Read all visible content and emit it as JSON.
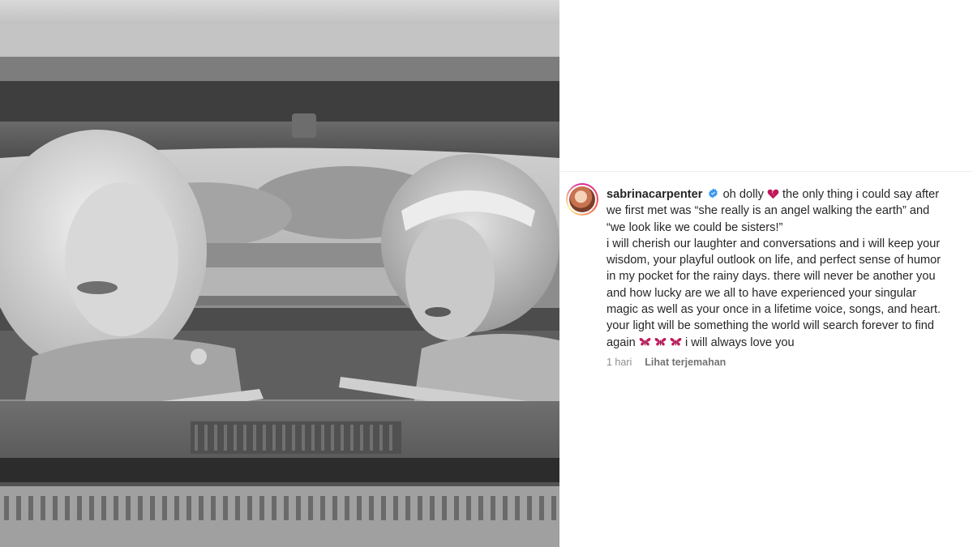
{
  "post": {
    "username": "sabrinacarpenter",
    "caption_lines": [
      "oh dolly",
      "the only thing i could say after",
      "we first met was “she really is an angel walking the earth” and",
      "“we look like we could be sisters!”",
      "i will cherish our laughter and conversations and i will keep your",
      "wisdom, your playful outlook on life, and perfect sense of humor",
      "in my pocket for the rainy days. there will never be another you",
      "and how lucky are we all to have experienced your singular",
      "magic as well as your once in a lifetime voice, songs, and heart.",
      "your light will be something the world will search forever to find",
      "again",
      "i will always love you"
    ],
    "timestamp": "1 hari",
    "translate_label": "Lihat terjemahan"
  },
  "icons": {
    "verified": "verified-badge-icon",
    "broken_heart": "broken-heart-emoji",
    "butterfly": "butterfly-emoji"
  },
  "colors": {
    "verified_blue": "#3897f0",
    "emoji_pink": "#c2185b",
    "text": "#262626",
    "muted": "#8e8e8e"
  }
}
